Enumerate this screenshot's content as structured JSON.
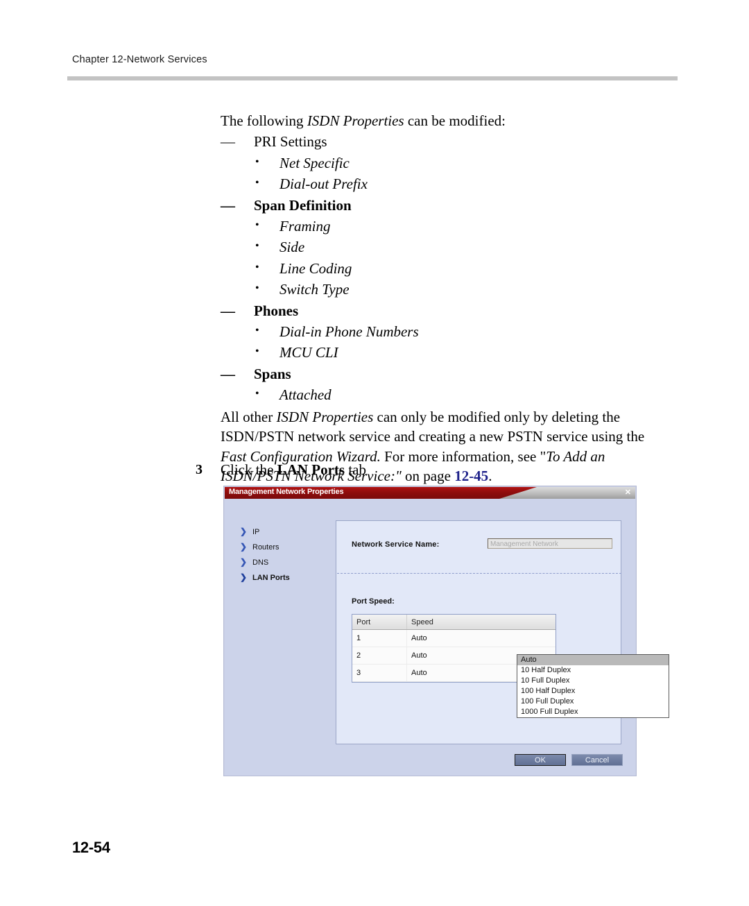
{
  "header": {
    "running_head": "Chapter 12-Network Services"
  },
  "body": {
    "intro": {
      "pre": "The following ",
      "italic": "ISDN Properties",
      "post": " can be modified:"
    },
    "groups": [
      {
        "label": "PRI Settings",
        "bold": false,
        "items": [
          "Net Specific",
          "Dial-out Prefix"
        ]
      },
      {
        "label": "Span Definition",
        "bold": true,
        "items": [
          "Framing",
          "Side",
          "Line Coding",
          "Switch Type"
        ]
      },
      {
        "label": "Phones",
        "bold": true,
        "items": [
          "Dial-in Phone Numbers",
          "MCU CLI"
        ]
      },
      {
        "label": "Spans",
        "bold": true,
        "items": [
          "Attached"
        ]
      }
    ],
    "closing": {
      "seg1": "All other ",
      "em1": "ISDN Properties",
      "seg2": " can only be modified only by deleting the ISDN/PSTN network service and creating a new PSTN service using the ",
      "em2": "Fast Configuration Wizard.",
      "seg3": " For more information, see \"",
      "em3": "To Add an ISDN/PSTN Network Service:\"",
      "seg4": " on page ",
      "page_link": "12-45",
      "seg5": "."
    }
  },
  "step": {
    "number": "3",
    "pre": "Click the ",
    "bold": "LAN Ports",
    "post": " tab"
  },
  "dialog": {
    "title": "Management Network Properties",
    "close_glyph": "✕",
    "nav": [
      {
        "label": "IP",
        "active": false
      },
      {
        "label": "Routers",
        "active": false
      },
      {
        "label": "DNS",
        "active": false
      },
      {
        "label": "LAN Ports",
        "active": true
      }
    ],
    "service_name": {
      "label": "Network Service Name:",
      "value": "Management Network"
    },
    "port_speed": {
      "label": "Port Speed:",
      "columns": [
        "Port",
        "Speed"
      ],
      "rows": [
        {
          "port": "1",
          "speed": "Auto"
        },
        {
          "port": "2",
          "speed": "Auto"
        },
        {
          "port": "3",
          "speed": "Auto"
        }
      ],
      "dropdown_options": [
        "Auto",
        "10 Half Duplex",
        "10 Full Duplex",
        "100 Half Duplex",
        "100 Full Duplex",
        "1000 Full Duplex"
      ],
      "dropdown_selected": "Auto"
    },
    "buttons": {
      "ok": "OK",
      "cancel": "Cancel"
    }
  },
  "folio": "12-54",
  "colors": {
    "titlebar_red": "#8f0d0d",
    "dialog_bg": "#ccd3ea",
    "panel_bg": "#e2e8f8",
    "link_blue": "#1d2089",
    "rule_gray": "#c3c3c3"
  }
}
